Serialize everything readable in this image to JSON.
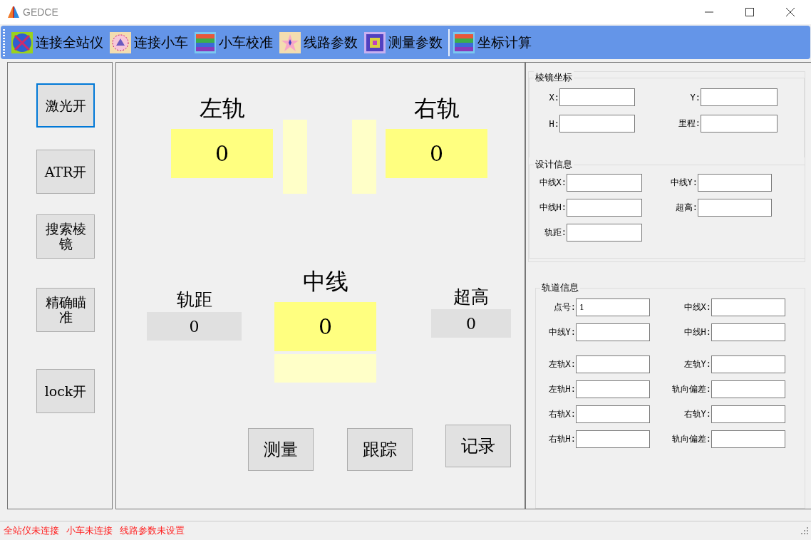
{
  "window": {
    "title": "GEDCE"
  },
  "toolbar": [
    {
      "label": "连接全站仪",
      "kind": "station"
    },
    {
      "label": "连接小车",
      "kind": "cart"
    },
    {
      "label": "小车校准",
      "kind": "stripes"
    },
    {
      "label": "线路参数",
      "kind": "star"
    },
    {
      "label": "测量参数",
      "kind": "squares"
    },
    {
      "label": "坐标计算",
      "kind": "stripes",
      "separator": true
    }
  ],
  "side_buttons": [
    {
      "label": "激光开",
      "focused": true
    },
    {
      "label": "ATR开",
      "focused": false
    },
    {
      "label": "搜索棱镜",
      "focused": false
    },
    {
      "label": "精确瞄准",
      "focused": false
    },
    {
      "label": "lock开",
      "focused": false
    }
  ],
  "rails": {
    "left": {
      "label": "左轨",
      "value": "0"
    },
    "right": {
      "label": "右轨",
      "value": "0"
    }
  },
  "middle": {
    "gauge": {
      "label": "轨距",
      "value": "0"
    },
    "center": {
      "label": "中线",
      "value": "0"
    },
    "superelevation": {
      "label": "超高",
      "value": "0"
    }
  },
  "actions": [
    "测量",
    "跟踪",
    "记录"
  ],
  "prism": {
    "title": "棱镜坐标",
    "fields": [
      {
        "label": "X:"
      },
      {
        "label": "Y:"
      },
      {
        "label": "H:"
      },
      {
        "label": "里程:"
      }
    ]
  },
  "design": {
    "title": "设计信息",
    "fields": [
      {
        "label": "中线X:"
      },
      {
        "label": "中线Y:"
      },
      {
        "label": "中线H:"
      },
      {
        "label": "超高:"
      },
      {
        "label": "轨距:"
      }
    ]
  },
  "track": {
    "title": "轨道信息",
    "groups": [
      [
        {
          "label": "点号:",
          "value": "1"
        },
        {
          "label": "中线X:"
        },
        {
          "label": "中线Y:"
        },
        {
          "label": "中线H:"
        }
      ],
      [
        {
          "label": "左轨X:"
        },
        {
          "label": "左轨Y:"
        },
        {
          "label": "左轨H:"
        },
        {
          "label": "轨向偏差:"
        },
        {
          "label": "右轨X:"
        },
        {
          "label": "右轨Y:"
        },
        {
          "label": "右轨H:"
        },
        {
          "label": "轨向偏差:"
        }
      ]
    ]
  },
  "status_bar": [
    "全站仪未连接",
    "小车未连接",
    "线路参数未设置"
  ]
}
